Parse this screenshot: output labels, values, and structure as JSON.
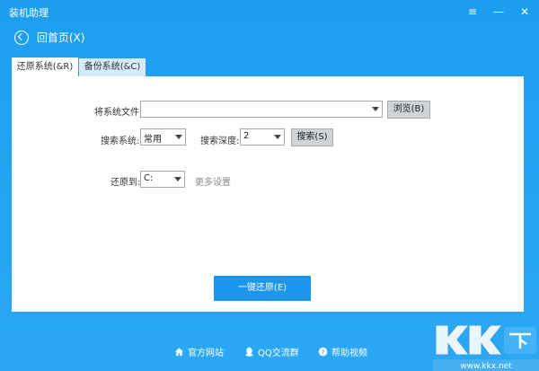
{
  "window": {
    "title": "装机助理",
    "buttons": {
      "menu": "≡",
      "minimize": "—",
      "close": "✕"
    }
  },
  "nav": {
    "home_label": "回首页(X)"
  },
  "tabs": [
    {
      "label": "还原系统(&R)",
      "active": true
    },
    {
      "label": "备份系统(&C)",
      "active": false
    }
  ],
  "form": {
    "system_file_label": "将系统文件:",
    "system_file_value": "",
    "browse_label": "浏览(B)",
    "search_system_label": "搜索系统:",
    "search_system_value": "常用",
    "search_depth_label": "搜索深度:",
    "search_depth_value": "2",
    "search_button_label": "搜索(S)",
    "restore_to_label": "还原到:",
    "restore_to_value": "C:",
    "more_settings_label": "更多设置",
    "one_key_restore_label": "一键还原(E)"
  },
  "footer": {
    "official_site": "官方网站",
    "qq_group": "QQ交流群",
    "help_video": "帮助视频"
  },
  "watermark": {
    "brand": "KK下载",
    "url": "www.kkx.net"
  },
  "colors": {
    "background": "#1e9ef0",
    "accent_button": "#1c95ee",
    "panel": "#ffffff"
  }
}
